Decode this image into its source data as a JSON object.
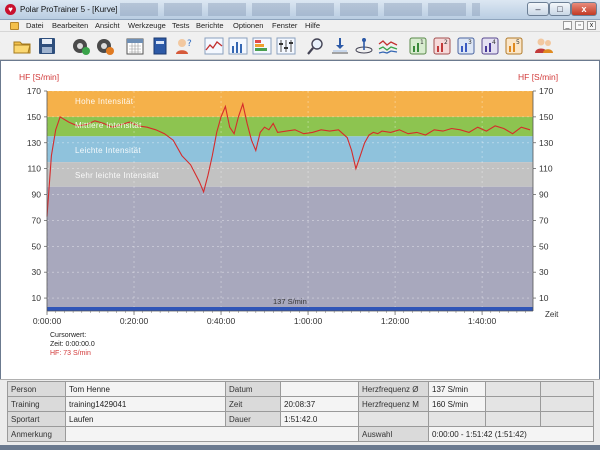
{
  "window": {
    "title": "Polar ProTrainer 5 - [Kurve]",
    "buttons": {
      "minimize": "–",
      "maximize": "□",
      "close": "x"
    }
  },
  "menu": [
    "Datei",
    "Bearbeiten",
    "Ansicht",
    "Werkzeuge",
    "Tests",
    "Berichte",
    "Optionen",
    "Fenster",
    "Hilfe"
  ],
  "toolbar_icons": [
    "open-folder-icon",
    "save-icon",
    "exercise-settings-icon",
    "user-settings-icon",
    "calendar-icon",
    "diary-book-icon",
    "person-help-icon",
    "curve-view-icon",
    "bar-chart-icon",
    "zones-chart-icon",
    "equalizer-icon",
    "zoom-icon",
    "analyze-icon",
    "marker-icon",
    "multi-curve-icon",
    "report-1-icon",
    "report-2-icon",
    "report-3-icon",
    "report-4-icon",
    "report-5-icon",
    "users-icon"
  ],
  "chart_data": {
    "type": "line",
    "ylabel_left": "HF [S/min]",
    "ylabel_right": "HF [S/min]",
    "xlabel": "Zeit",
    "ylim": [
      0,
      170
    ],
    "yticks": [
      10,
      30,
      50,
      70,
      90,
      110,
      130,
      150,
      170
    ],
    "xticks": [
      "0:00:00",
      "0:20:00",
      "0:40:00",
      "1:00:00",
      "1:20:00",
      "1:40:00"
    ],
    "xlim_min": [
      0,
      111.7
    ],
    "grid": true,
    "average_hr": 137,
    "average_label": "137 S/min",
    "zones": [
      {
        "name": "Hohe Intensität",
        "from": 150,
        "to": 170,
        "color": "#f5b14a"
      },
      {
        "name": "Mittlere Intensität",
        "from": 135,
        "to": 150,
        "color": "#8dc450"
      },
      {
        "name": "Leichte Intensität",
        "from": 115,
        "to": 135,
        "color": "#8fc2dc"
      },
      {
        "name": "Sehr leichte Intensität",
        "from": 96,
        "to": 115,
        "color": "#c2c2c2"
      }
    ],
    "series": [
      {
        "name": "HF",
        "color": "#d62b2b",
        "x": [
          0,
          1,
          2,
          3,
          5,
          7,
          9,
          11,
          13,
          15,
          17,
          19,
          21,
          23,
          25,
          27,
          29,
          31,
          33,
          35,
          36,
          37,
          38,
          39,
          40,
          41,
          42,
          43,
          44,
          45,
          46,
          47,
          48,
          49,
          50,
          51,
          52,
          53,
          55,
          57,
          59,
          61,
          63,
          65,
          67,
          69,
          70,
          71,
          72,
          73,
          74,
          75,
          76,
          77,
          79,
          81,
          83,
          85,
          87,
          89,
          91,
          93,
          95,
          97,
          99,
          101,
          103,
          105,
          107,
          109,
          111
        ],
        "values": [
          73,
          120,
          140,
          150,
          146,
          143,
          144,
          147,
          145,
          142,
          144,
          146,
          143,
          142,
          140,
          137,
          132,
          120,
          113,
          100,
          92,
          105,
          120,
          138,
          150,
          158,
          142,
          137,
          150,
          160,
          145,
          132,
          124,
          138,
          142,
          140,
          145,
          138,
          139,
          140,
          137,
          138,
          140,
          139,
          140,
          134,
          124,
          110,
          120,
          130,
          136,
          138,
          137,
          139,
          138,
          140,
          137,
          138,
          136,
          140,
          139,
          141,
          140,
          138,
          142,
          139,
          143,
          141,
          137,
          142,
          140
        ]
      }
    ]
  },
  "cursor": {
    "line1": "Cursorwert:",
    "line2": "Zeit: 0:00:00.0",
    "line3": "HF: 73 S/min"
  },
  "info": {
    "person_label": "Person",
    "person_value": "Tom Henne",
    "training_label": "Training",
    "training_value": "training1429041",
    "sportart_label": "Sportart",
    "sportart_value": "Laufen",
    "anmerkung_label": "Anmerkung",
    "datum_label": "Datum",
    "datum_value": "",
    "zeit_label": "Zeit",
    "zeit_value": "20:08:37",
    "dauer_label": "Dauer",
    "dauer_value": "1:51:42.0",
    "hf_avg_label": "Herzfrequenz Ø",
    "hf_avg_value": "137 S/min",
    "hf_max_label": "Herzfrequenz M",
    "hf_max_value": "160 S/min",
    "auswahl_label": "Auswahl",
    "auswahl_value": "0:00:00 - 1:51:42 (1:51:42)"
  }
}
